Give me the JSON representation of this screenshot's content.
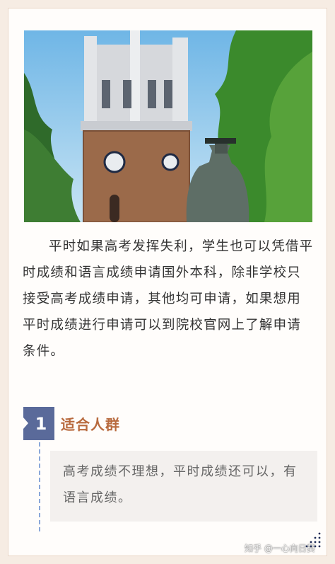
{
  "paragraph": "平时如果高考发挥失利，学生也可以凭借平时成绩和语言成绩申请国外本科，除非学校只接受高考成绩申请，其他均可申请，如果想用平时成绩进行申请可以到院校官网上了解申请条件。",
  "section": {
    "number": "1",
    "title": "适合人群",
    "body": "高考成绩不理想，平时成绩还可以，有语言成绩。"
  },
  "watermark": "知乎 @一心向日葵",
  "colors": {
    "accent": "#5a6a9a",
    "title": "#b86a3e",
    "dash": "#8aa7d9"
  }
}
